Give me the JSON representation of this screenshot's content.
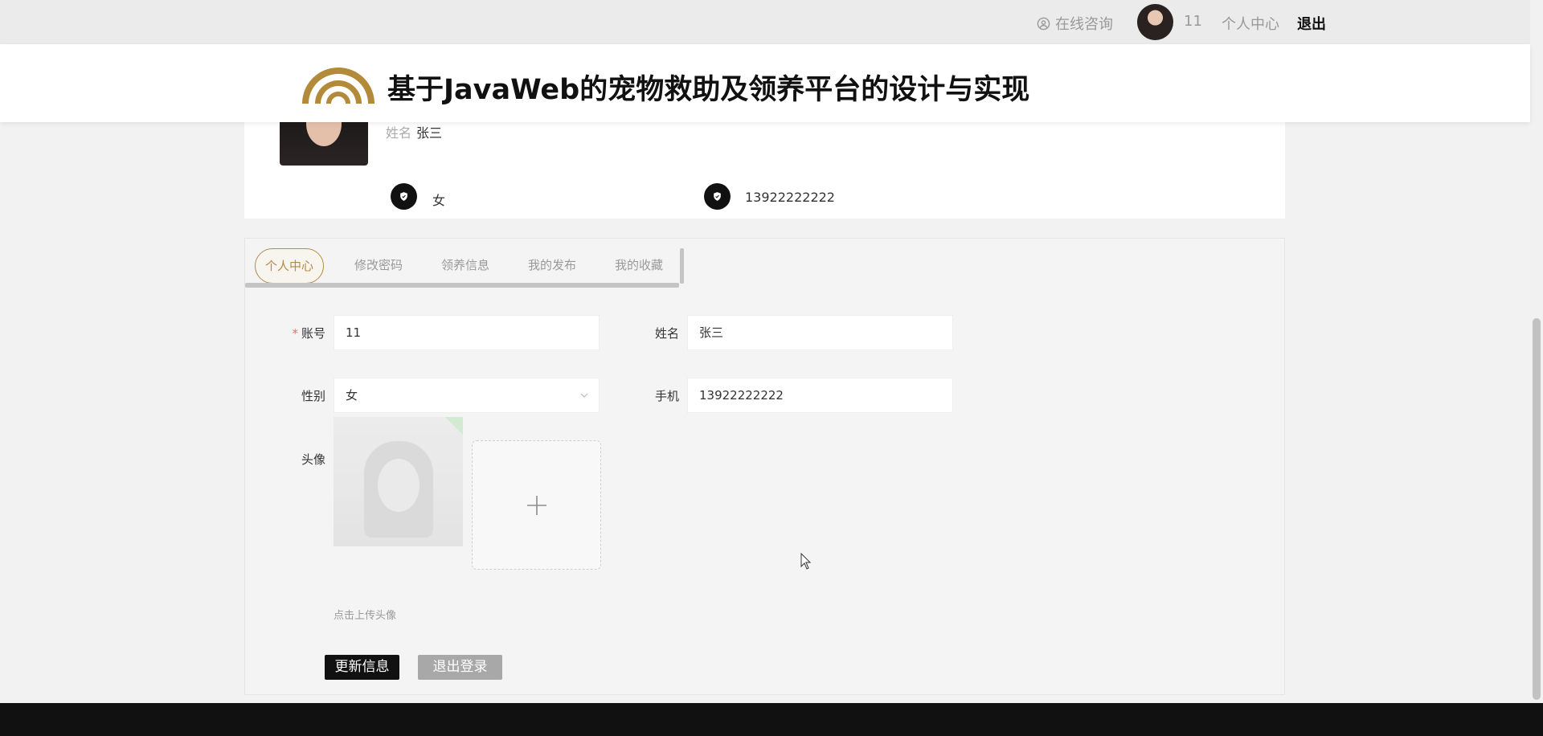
{
  "topbar": {
    "consult_label": "在线咨询",
    "username": "11",
    "center_label": "个人中心",
    "logout_label": "退出"
  },
  "header": {
    "site_title": "基于JavaWeb的宠物救助及领养平台的设计与实现",
    "logo_color": "#b28a3a"
  },
  "profile": {
    "name_label": "姓名",
    "name_value": "张三",
    "gender": "女",
    "phone": "13922222222"
  },
  "tabs": [
    {
      "label": "个人中心",
      "active": true
    },
    {
      "label": "修改密码",
      "active": false
    },
    {
      "label": "领养信息",
      "active": false
    },
    {
      "label": "我的发布",
      "active": false
    },
    {
      "label": "我的收藏",
      "active": false
    }
  ],
  "form": {
    "account_label": "账号",
    "account_value": "11",
    "name_label": "姓名",
    "name_value": "张三",
    "gender_label": "性别",
    "gender_value": "女",
    "phone_label": "手机",
    "phone_value": "13922222222",
    "avatar_label": "头像",
    "upload_hint": "点击上传头像"
  },
  "buttons": {
    "update_label": "更新信息",
    "logout_label": "退出登录"
  },
  "colors": {
    "accent": "#b28a4a",
    "primary_button": "#111111",
    "secondary_button": "#a8a8a8"
  }
}
